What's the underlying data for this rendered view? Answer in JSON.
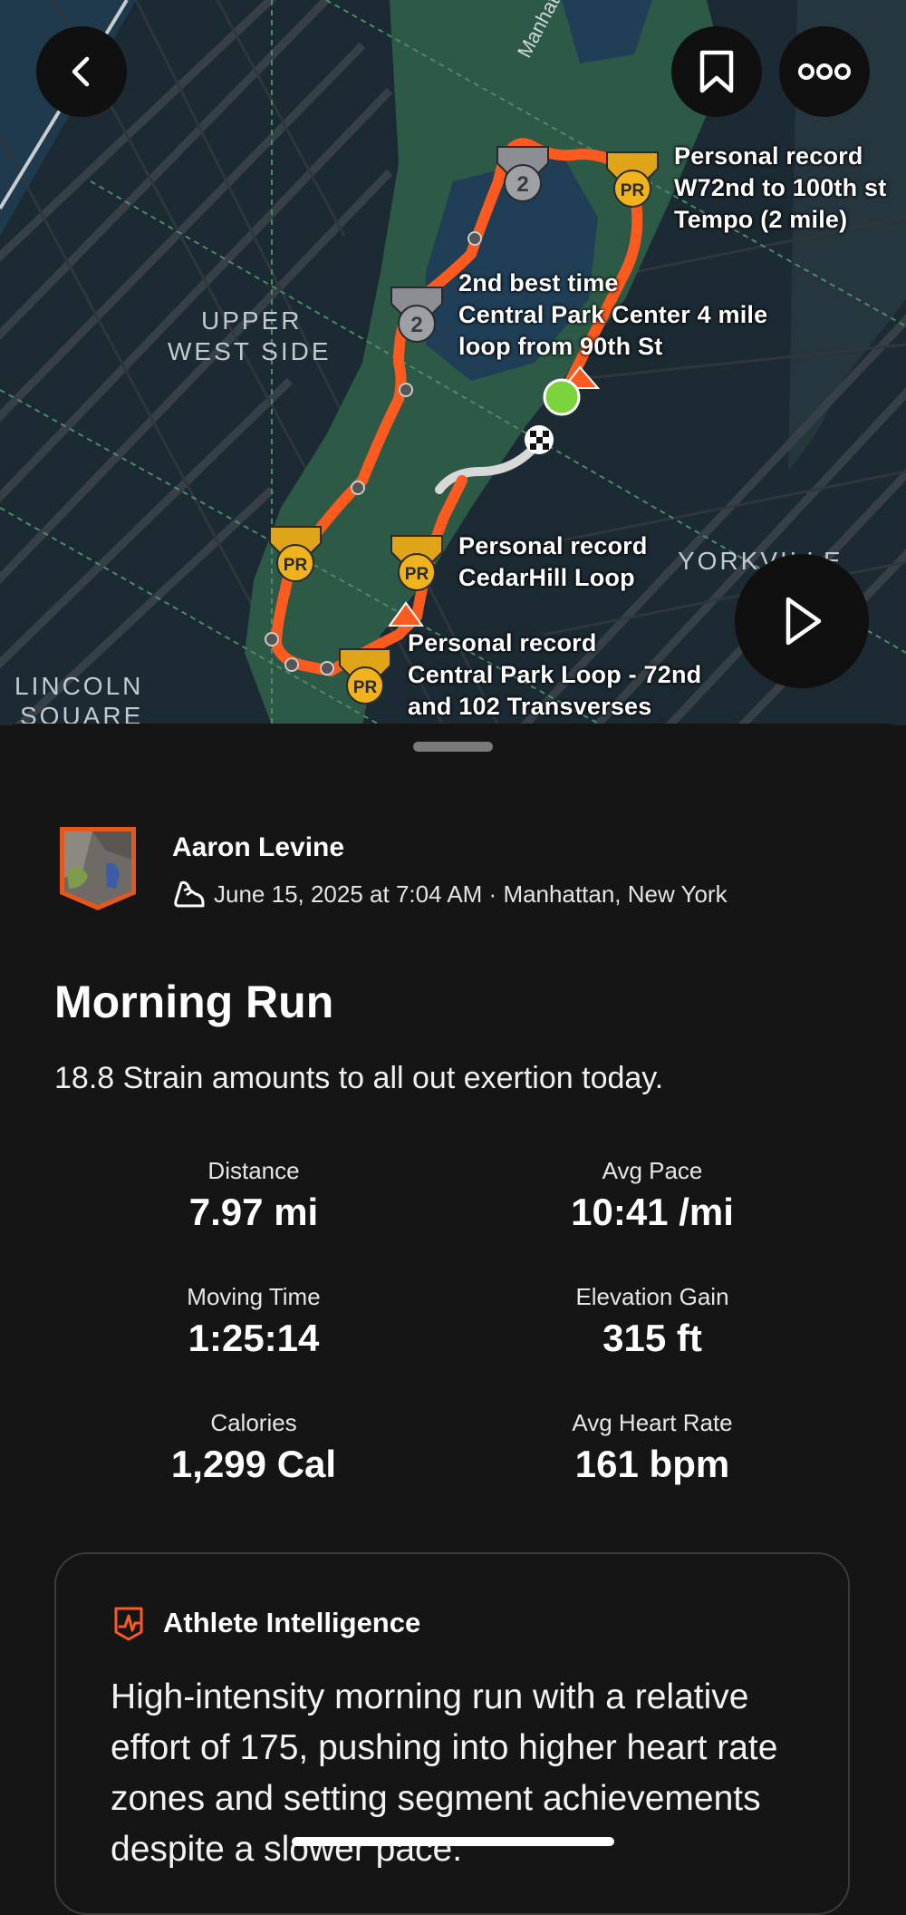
{
  "map": {
    "area_labels": [
      "UPPER",
      "WEST SIDE",
      "YORKVILLE",
      "LINCOLN",
      "SQUARE"
    ],
    "street_label": "Manhattan Ave",
    "segments": [
      {
        "badge": "PR",
        "line1": "Personal record",
        "line2": "W72nd to 100th st",
        "line3": "Tempo (2 mile)"
      },
      {
        "badge": "2",
        "line1": "2nd best time",
        "line2": "Central Park Center 4 mile",
        "line3": "loop from 90th St"
      },
      {
        "badge": "PR",
        "line1": "Personal record",
        "line2": "CedarHill Loop",
        "line3": ""
      },
      {
        "badge": "PR",
        "line1": "Personal record",
        "line2": "Central Park Loop - 72nd",
        "line3": "and 102 Transverses"
      }
    ],
    "route_color": "#fc5a1f",
    "pr_color": "#f1b31c"
  },
  "toolbar": {
    "back_icon": "chevron-left-icon",
    "bookmark_icon": "bookmark-icon",
    "more_icon": "more-icon",
    "play_icon": "play-icon"
  },
  "activity": {
    "athlete_name": "Aaron Levine",
    "meta": "June 15, 2025 at 7:04 AM · Manhattan, New York",
    "title": "Morning Run",
    "description": "18.8 Strain amounts to all out exertion today."
  },
  "stats": [
    {
      "label": "Distance",
      "value": "7.97 mi"
    },
    {
      "label": "Avg Pace",
      "value": "10:41 /mi"
    },
    {
      "label": "Moving Time",
      "value": "1:25:14"
    },
    {
      "label": "Elevation Gain",
      "value": "315 ft"
    },
    {
      "label": "Calories",
      "value": "1,299 Cal"
    },
    {
      "label": "Avg Heart Rate",
      "value": "161 bpm"
    }
  ],
  "intelligence": {
    "title": "Athlete Intelligence",
    "text": "High-intensity morning run with a relative effort of 175, pushing into higher heart rate zones and setting segment achievements despite a slower pace."
  }
}
